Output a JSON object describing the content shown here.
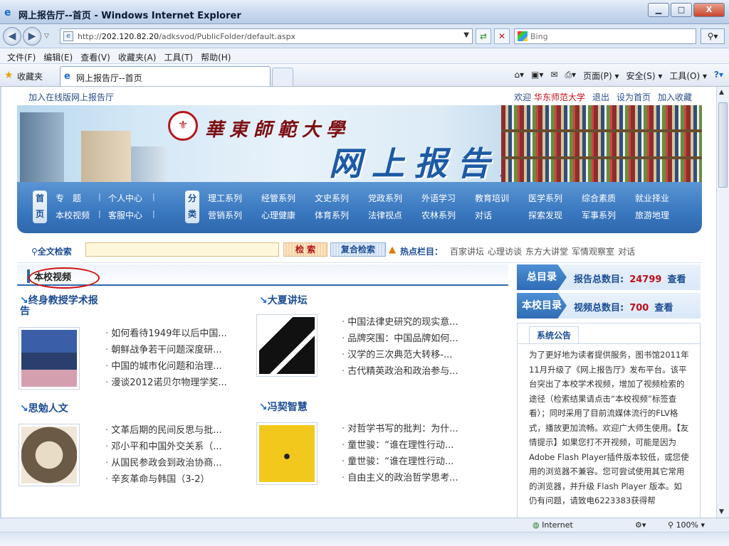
{
  "window": {
    "title": "网上报告厅--首页 - Windows Internet Explorer",
    "minimize": "▁",
    "maximize": "□",
    "close": "X"
  },
  "address": {
    "host": "202.120.82.20",
    "path": "/adksvod/PublicFolder/default.aspx",
    "prefix": "http://",
    "search_placeholder": "Bing"
  },
  "menu": [
    "文件(F)",
    "编辑(E)",
    "查看(V)",
    "收藏夹(A)",
    "工具(T)",
    "帮助(H)"
  ],
  "favorites": {
    "label": "收藏夹",
    "tab_title": "网上报告厅--首页"
  },
  "commands": [
    "页面(P) ▾",
    "安全(S) ▾",
    "工具(O) ▾"
  ],
  "site": {
    "top_left": "加入在线版网上报告厅",
    "welcome": "欢迎",
    "school": "华东师范大学",
    "logout": "退出",
    "set_home": "设为首页",
    "add_fav": "加入收藏",
    "university_name": "華東師範大學",
    "site_name": "网上报告厅"
  },
  "nav": {
    "tag1": "首页",
    "tag2": "分类",
    "row1_left": [
      "专　题",
      "个人中心"
    ],
    "row2_left": [
      "本校视频",
      "客服中心"
    ],
    "row1_right": [
      "理工系列",
      "经管系列",
      "文史系列",
      "党政系列",
      "外语学习",
      "教育培训",
      "医学系列",
      "综合素质",
      "就业择业"
    ],
    "row2_right": [
      "营销系列",
      "心理健康",
      "体育系列",
      "法律视点",
      "农林系列",
      "对话",
      "探索发现",
      "军事系列",
      "旅游地理"
    ]
  },
  "search": {
    "label": "全文检索",
    "value": "",
    "search_btn": "检 索",
    "advanced_btn": "复合检索",
    "hot_label": "热点栏目：",
    "hot_links": [
      "百家讲坛",
      "心理访谈",
      "东方大讲堂",
      "军情观察室",
      "对话"
    ]
  },
  "section": {
    "title": "本校视频"
  },
  "categories": [
    {
      "title": "终身教授学术报告",
      "links": [
        "如何看待1949年以后中国...",
        "朝鲜战争若干问题深度研...",
        "中国的城市化问题和治理...",
        "漫谈2012诺贝尔物理学奖..."
      ]
    },
    {
      "title": "大夏讲坛",
      "links": [
        "中国法律史研究的现实意...",
        "品牌突围：中国品牌如何...",
        "汉学的三次典范大转移-...",
        "古代精英政治和政治参与..."
      ]
    },
    {
      "title": "思勉人文",
      "links": [
        "文革后期的民间反思与批...",
        "邓小平和中国外交关系（...",
        "从国民参政会到政治协商...",
        "辛亥革命与韩国（3-2）"
      ]
    },
    {
      "title": "冯契智慧",
      "links": [
        "对哲学书写的批判：为什...",
        "童世骏：“谁在理性行动...",
        "童世骏：“谁在理性行动...",
        "自由主义的政治哲学思考..."
      ]
    }
  ],
  "sidebar": {
    "catalog_badge": "总目录",
    "catalog_label": "报告总数目:",
    "catalog_count": "24799",
    "view": "查看",
    "school_badge": "本校目录",
    "school_label": "视频总数目:",
    "school_count": "700",
    "notice_title": "系统公告",
    "notice_text": "为了更好地为读者提供服务，图书馆2011年11月升级了《网上报告厅》发布平台。该平台突出了本校学术视频，增加了视频检索的途径（检索结果请点击“本校视频”标签查看）；同时采用了目前流媒体流行的FLV格式，播放更加流畅。欢迎广大师生使用。【友情提示】如果您打不开视频，可能是因为Adobe Flash Player插件版本较低，或您使用的浏览器不兼容。您可尝试使用其它常用的浏览器，并升级 Flash Player 版本。如仍有问题，请致电6223383获得帮"
  },
  "status": {
    "zone": "Internet",
    "zoom": "100%"
  },
  "colors": {
    "accent": "#2f68ad",
    "nav_bg": "#3977bf",
    "red": "#c0101a"
  },
  "icons": [
    "ie-icon",
    "back-icon",
    "forward-icon",
    "refresh-icon",
    "stop-icon",
    "search-icon",
    "star-icon",
    "home-icon",
    "feed-icon",
    "print-icon",
    "help-icon",
    "globe-icon"
  ]
}
